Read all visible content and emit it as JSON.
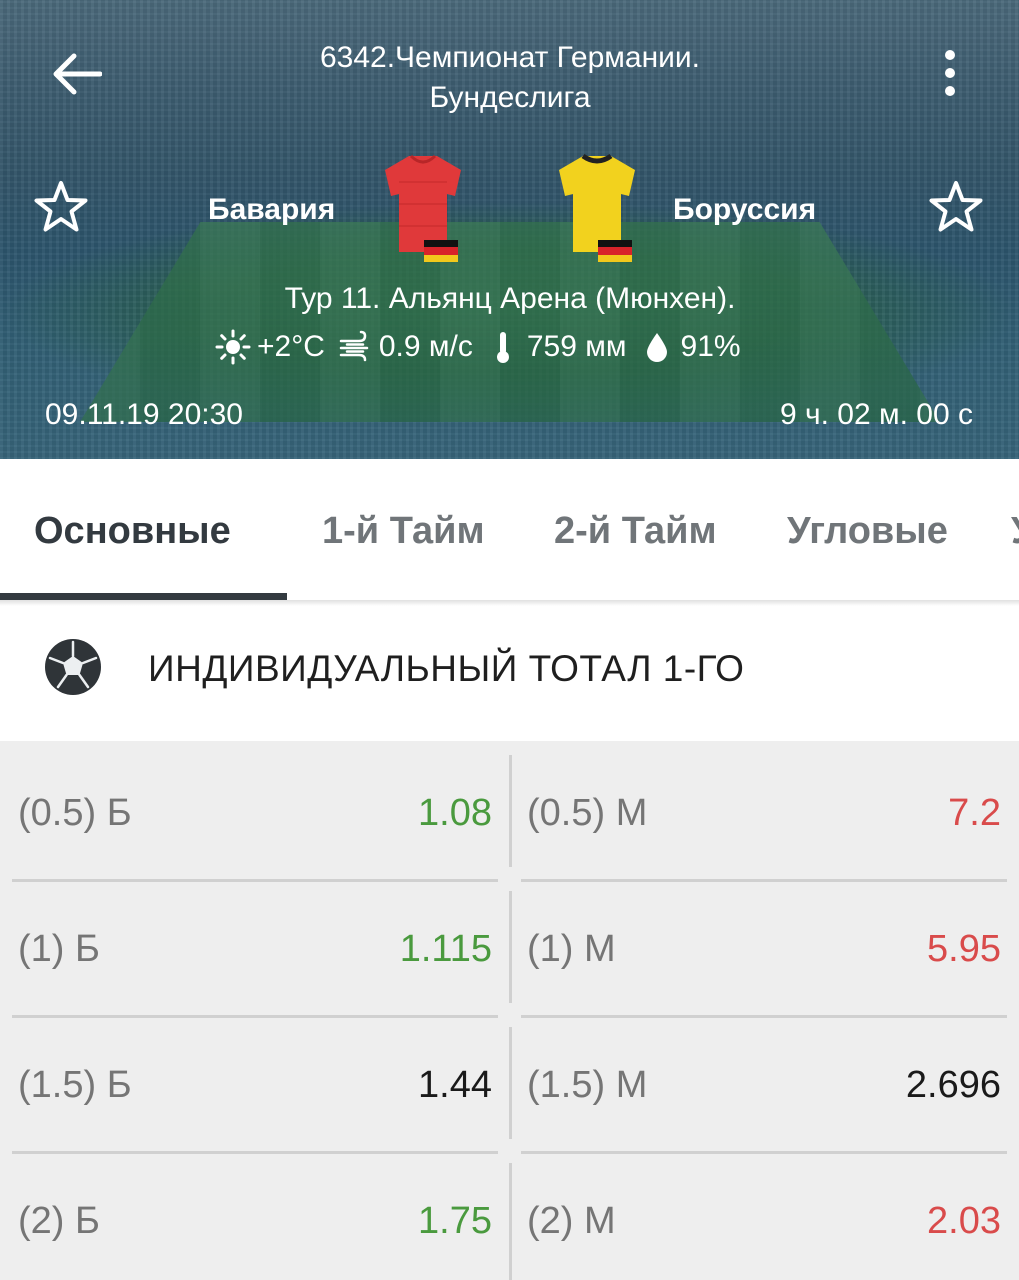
{
  "header": {
    "league_line1": "6342.Чемпионат Германии.",
    "league_line2": "Бундеслига",
    "home_team": "Бавария",
    "away_team": "Боруссия",
    "home_jersey_color": "#e0393a",
    "away_jersey_color": "#f2d21e",
    "venue": "Тур 11. Альянц Арена (Мюнхен).",
    "weather": {
      "temperature": "+2°C",
      "wind": "0.9 м/с",
      "pressure": "759 мм",
      "humidity": "91%"
    },
    "datetime": "09.11.19 20:30",
    "countdown": "9 ч. 02 м. 00 с",
    "icons": [
      "back-arrow-icon",
      "more-vert-icon",
      "star-outline-icon",
      "sun-icon",
      "wind-icon",
      "thermometer-icon",
      "drop-icon"
    ]
  },
  "tabs": [
    {
      "label": "Основные",
      "active": true
    },
    {
      "label": "1-й Тайм",
      "active": false
    },
    {
      "label": "2-й Тайм",
      "active": false
    },
    {
      "label": "Угловые",
      "active": false
    },
    {
      "label": "У",
      "active": false
    }
  ],
  "section": {
    "title": "ИНДИВИДУАЛЬНЫЙ ТОТАЛ 1-ГО",
    "icon": "soccer-ball-icon"
  },
  "odds": [
    {
      "over_label": "(0.5) Б",
      "over_value": "1.08",
      "over_color": "#4a9a3e",
      "under_label": "(0.5) М",
      "under_value": "7.2",
      "under_color": "#d94b4b"
    },
    {
      "over_label": "(1) Б",
      "over_value": "1.115",
      "over_color": "#4a9a3e",
      "under_label": "(1) М",
      "under_value": "5.95",
      "under_color": "#d94b4b"
    },
    {
      "over_label": "(1.5) Б",
      "over_value": "1.44",
      "over_color": "#1a1a1a",
      "under_label": "(1.5) М",
      "under_value": "2.696",
      "under_color": "#1a1a1a"
    },
    {
      "over_label": "(2) Б",
      "over_value": "1.75",
      "over_color": "#4a9a3e",
      "under_label": "(2) М",
      "under_value": "2.03",
      "under_color": "#d94b4b"
    }
  ],
  "colors": {
    "active_tab": "#333a40",
    "inactive_tab": "#707579",
    "odd_up": "#4a9a3e",
    "odd_down": "#d94b4b"
  }
}
